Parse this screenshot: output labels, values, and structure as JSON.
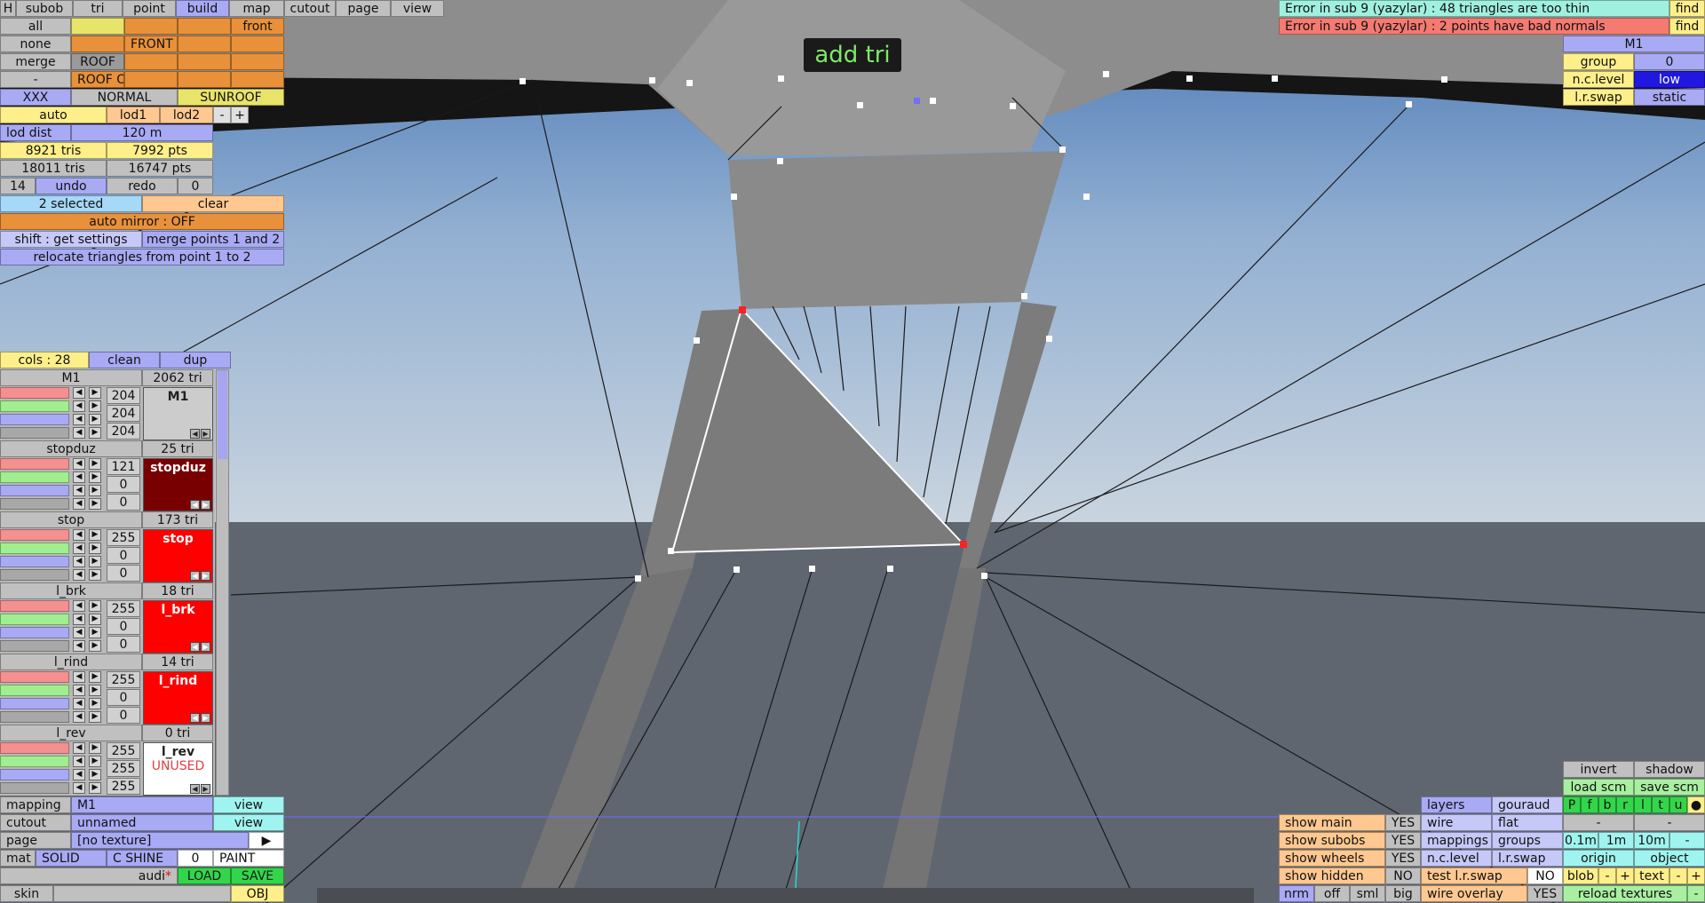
{
  "toolbar_tabs": [
    {
      "label": "H"
    },
    {
      "label": "subob"
    },
    {
      "label": "tri"
    },
    {
      "label": "point"
    },
    {
      "label": "build"
    },
    {
      "label": "map"
    },
    {
      "label": "cutout"
    },
    {
      "label": "page"
    },
    {
      "label": "view"
    }
  ],
  "left_panel": {
    "all": "all",
    "front": "front",
    "none": "none",
    "front_g": "FRONT G",
    "merge": "merge",
    "roof": "ROOF",
    "dash": "-",
    "roof_op": "ROOF OP",
    "xxx": "XXX",
    "normal": "NORMAL",
    "sunroof": "SUNROOF",
    "auto": "auto",
    "lod1": "lod1",
    "lod2": "lod2",
    "minus": "-",
    "plus": "+",
    "lod_dist": "lod dist",
    "lod_dist_value": "120 m",
    "tris1": "8921 tris",
    "pts1": "7992 pts",
    "tris2": "18011 tris",
    "pts2": "16747 pts",
    "undo_count": "14",
    "undo": "undo",
    "redo": "redo",
    "redo_count": "0",
    "selected": "2 selected",
    "clear": "clear",
    "auto_mirror": "auto mirror : OFF",
    "shift_settings": "shift : get settings",
    "merge_points": "merge points 1 and 2",
    "relocate": "relocate triangles from point 1 to 2"
  },
  "materials_header": {
    "cols": "cols : 28",
    "clean": "clean",
    "dup": "dup"
  },
  "materials": [
    {
      "name": "M1",
      "tris": "2062 tri",
      "r": "204",
      "g": "204",
      "b": "204",
      "preview": "M1",
      "preview_color": "#cccccc",
      "preview_text_color": "#222222",
      "sub": ""
    },
    {
      "name": "stopduz",
      "tris": "25 tri",
      "r": "121",
      "g": "0",
      "b": "0",
      "preview": "stopduz",
      "preview_color": "#790000",
      "preview_text_color": "#ffffff",
      "sub": ""
    },
    {
      "name": "stop",
      "tris": "173 tri",
      "r": "255",
      "g": "0",
      "b": "0",
      "preview": "stop",
      "preview_color": "#ff0000",
      "preview_text_color": "#ffffff",
      "sub": ""
    },
    {
      "name": "l_brk",
      "tris": "18 tri",
      "r": "255",
      "g": "0",
      "b": "0",
      "preview": "l_brk",
      "preview_color": "#ff0000",
      "preview_text_color": "#ffffff",
      "sub": ""
    },
    {
      "name": "l_rind",
      "tris": "14 tri",
      "r": "255",
      "g": "0",
      "b": "0",
      "preview": "l_rind",
      "preview_color": "#ff0000",
      "preview_text_color": "#ffffff",
      "sub": ""
    },
    {
      "name": "l_rev",
      "tris": "0 tri",
      "r": "255",
      "g": "255",
      "b": "255",
      "preview": "l_rev",
      "preview_color": "#ffffff",
      "preview_text_color": "#222222",
      "sub": "UNUSED"
    }
  ],
  "bottom_left": {
    "mapping_label": "mapping",
    "mapping_value": "M1",
    "mapping_view": "view",
    "cutout_label": "cutout",
    "cutout_value": "unnamed",
    "cutout_view": "view",
    "page_label": "page",
    "page_value": "[no texture]",
    "mat": "mat",
    "solid": "SOLID",
    "c_shine": "C SHINE",
    "zero": "0",
    "paint": "PAINT",
    "file_name": "audi",
    "modified_mark": "*",
    "load": "LOAD",
    "save": "SAVE",
    "skin": "skin",
    "obj": "OBJ"
  },
  "errors": [
    {
      "text": "Error in sub 9 (yazylar) : 48 triangles are too thin",
      "color": "#a0f0e0",
      "find": "find"
    },
    {
      "text": "Error in sub 9 (yazylar) : 2 points have bad normals",
      "color": "#f47a72",
      "find": "find"
    }
  ],
  "right_panel": {
    "m1": "M1",
    "group": "group",
    "group_value": "0",
    "nc_level": "n.c.level",
    "nc_value": "low",
    "lr_swap": "l.r.swap",
    "lr_value": "static"
  },
  "mode_label": "add tri",
  "bottom_right": {
    "invert": "invert",
    "shadow": "shadow",
    "load_scm": "load scm",
    "save_scm": "save scm",
    "show_main": "show main",
    "show_main_v": "YES",
    "show_subobs": "show subobs",
    "show_subobs_v": "YES",
    "show_wheels": "show wheels",
    "show_wheels_v": "YES",
    "show_hidden": "show hidden",
    "show_hidden_v": "NO",
    "nrm": "nrm",
    "off": "off",
    "sml": "sml",
    "big": "big",
    "layers": "layers",
    "gouraud": "gouraud",
    "wire": "wire",
    "flat": "flat",
    "mappings": "mappings",
    "groups": "groups",
    "nclevel": "n.c.level",
    "lrswap": "l.r.swap",
    "test_lr_swap": "test l.r.swap",
    "test_lr_v": "NO",
    "wire_overlay": "wire overlay",
    "wire_overlay_v": "YES",
    "layer_letters": [
      "P",
      "f",
      "b",
      "r",
      "l",
      "t",
      "u",
      "●"
    ],
    "dash1": "-",
    "dash2": "-",
    "grid1": "0.1m",
    "grid2": "1m",
    "grid3": "10m",
    "grid_minus": "-",
    "origin": "origin",
    "object": "object",
    "blob": "blob",
    "blob_minus": "-",
    "blob_plus": "+",
    "text": "text",
    "text_minus": "-",
    "text_plus": "+",
    "reload_textures": "reload textures",
    "reload_minus": "-"
  }
}
